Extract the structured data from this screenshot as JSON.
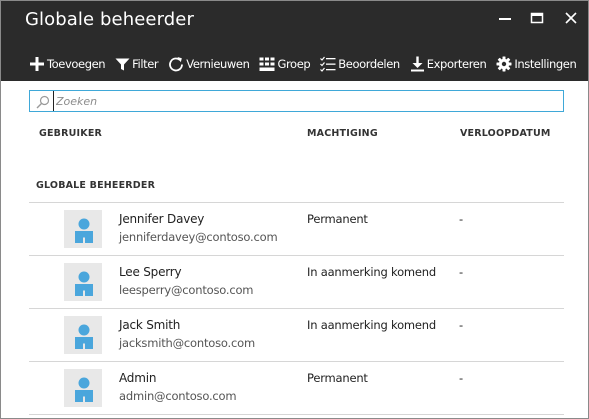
{
  "window": {
    "title": "Globale beheerder"
  },
  "toolbar": {
    "items": [
      {
        "label": "Toevoegen",
        "icon": "plus-icon"
      },
      {
        "label": "Filter",
        "icon": "filter-icon"
      },
      {
        "label": "Vernieuwen",
        "icon": "refresh-icon"
      },
      {
        "label": "Groep",
        "icon": "group-icon"
      },
      {
        "label": "Beoordelen",
        "icon": "review-icon"
      },
      {
        "label": "Exporteren",
        "icon": "download-icon"
      },
      {
        "label": "Instellingen",
        "icon": "gear-icon"
      }
    ]
  },
  "search": {
    "placeholder": "Zoeken",
    "value": ""
  },
  "columns": {
    "user": "GEBRUIKER",
    "permission": "MACHTIGING",
    "expiry": "VERLOOPDATUM"
  },
  "group": {
    "title": "GLOBALE BEHEERDER"
  },
  "users": [
    {
      "name": "Jennifer Davey",
      "email": "jenniferdavey@contoso.com",
      "permission": "Permanent",
      "expiry": "-"
    },
    {
      "name": "Lee Sperry",
      "email": "leesperry@contoso.com",
      "permission": "In aanmerking komend",
      "expiry": "-"
    },
    {
      "name": "Jack Smith",
      "email": "jacksmith@contoso.com",
      "permission": "In aanmerking komend",
      "expiry": "-"
    },
    {
      "name": "Admin",
      "email": "admin@contoso.com",
      "permission": "Permanent",
      "expiry": "-"
    }
  ],
  "colors": {
    "header_bg": "#2b2b2b",
    "search_border": "#3fa8d8",
    "avatar_blue": "#4aa6dc",
    "avatar_bg": "#e8e8e8"
  }
}
